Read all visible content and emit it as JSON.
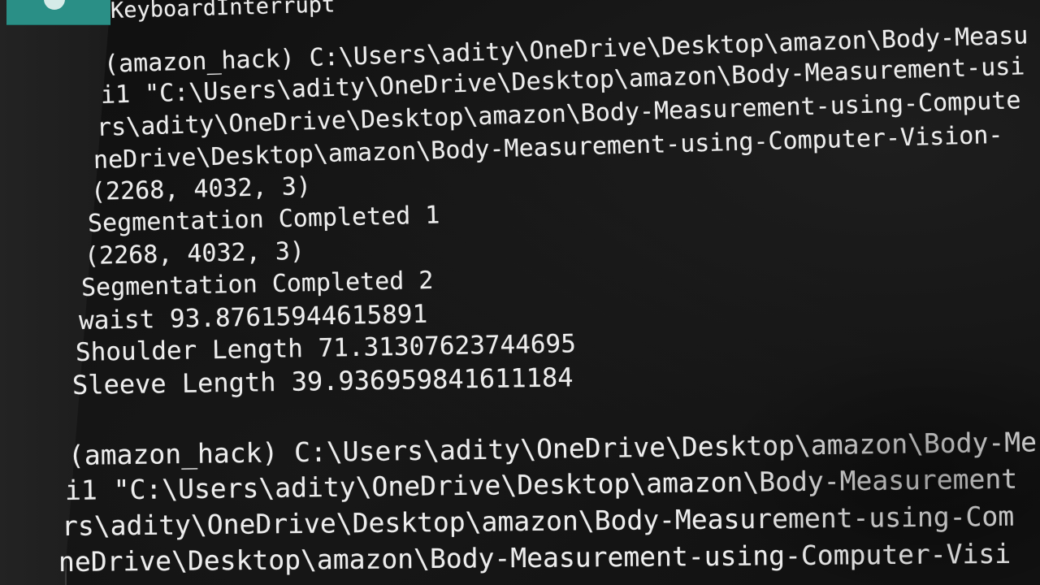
{
  "terminal": {
    "lines": [
      "KeyboardInterrupt",
      "(amazon_hack) C:\\Users\\adity\\OneDrive\\Desktop\\amazon\\Body-Measu",
      "i1 \"C:\\Users\\adity\\OneDrive\\Desktop\\amazon\\Body-Measurement-usi",
      "rs\\adity\\OneDrive\\Desktop\\amazon\\Body-Measurement-using-Compute",
      "neDrive\\Desktop\\amazon\\Body-Measurement-using-Computer-Vision-",
      "(2268, 4032, 3)",
      "Segmentation Completed 1",
      "(2268, 4032, 3)",
      "Segmentation Completed 2",
      "waist 93.87615944615891",
      "Shoulder Length 71.31307623744695",
      "Sleeve Length 39.936959841611184",
      "(amazon_hack) C:\\Users\\adity\\OneDrive\\Desktop\\amazon\\Body-Me",
      "i1 \"C:\\Users\\adity\\OneDrive\\Desktop\\amazon\\Body-Measurement",
      "rs\\adity\\OneDrive\\Desktop\\amazon\\Body-Measurement-using-Com",
      "neDrive\\Desktop\\amazon\\Body-Measurement-using-Computer-Visi"
    ]
  },
  "sidebar": {
    "active_tab_color": "#2a8f86"
  }
}
